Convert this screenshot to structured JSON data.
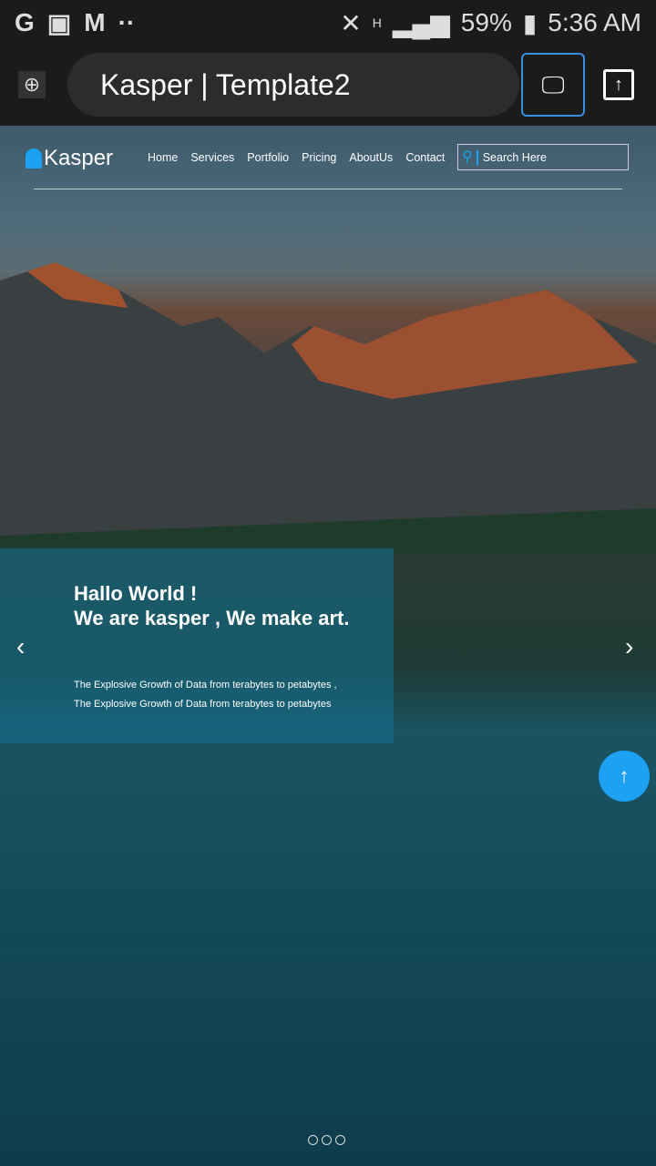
{
  "status_bar": {
    "battery": "59%",
    "time": "5:36 AM",
    "network": "H"
  },
  "browser": {
    "title": "Kasper | Template2"
  },
  "site": {
    "logo": "Kasper",
    "nav": [
      "Home",
      "Services",
      "Portfolio",
      "Pricing",
      "AboutUs",
      "Contact"
    ],
    "search_placeholder": "Search Here"
  },
  "hero": {
    "heading_line1": "Hallo World !",
    "heading_line2": "We are kasper , We make art.",
    "text_line1": "The Explosive Growth of Data from terabytes to petabytes ,",
    "text_line2": "The Explosive Growth of Data from terabytes to petabytes",
    "slides": 3
  },
  "colors": {
    "accent": "#1da1f2",
    "panel": "#146e8c"
  }
}
